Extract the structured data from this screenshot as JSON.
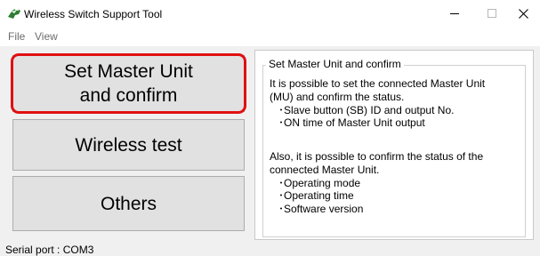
{
  "window": {
    "title": "Wireless Switch Support Tool",
    "icon": "green-bird-icon",
    "minimize": "–",
    "maximize": "☐",
    "close": "✕"
  },
  "menu": {
    "items": [
      "File",
      "View"
    ]
  },
  "buttons": {
    "master": "Set Master Unit\nand confirm",
    "wireless": "Wireless test",
    "others": "Others"
  },
  "colors": {
    "highlight": "#e01010",
    "button_bg": "#e1e1e1",
    "client_bg": "#f0f0f0"
  },
  "info": {
    "group_title": "Set Master Unit and confirm",
    "lines": [
      "It is possible to set the connected Master Unit",
      "(MU) and confirm the status.",
      "   ･Slave button (SB) ID and output No.",
      "   ･ON time of Master Unit output",
      "Also, it is possible to confirm the status of the",
      "connected Master Unit.",
      "   ･Operating mode",
      "   ･Operating time",
      "   ･Software version"
    ]
  },
  "status": {
    "text": "Serial port :   COM3"
  }
}
